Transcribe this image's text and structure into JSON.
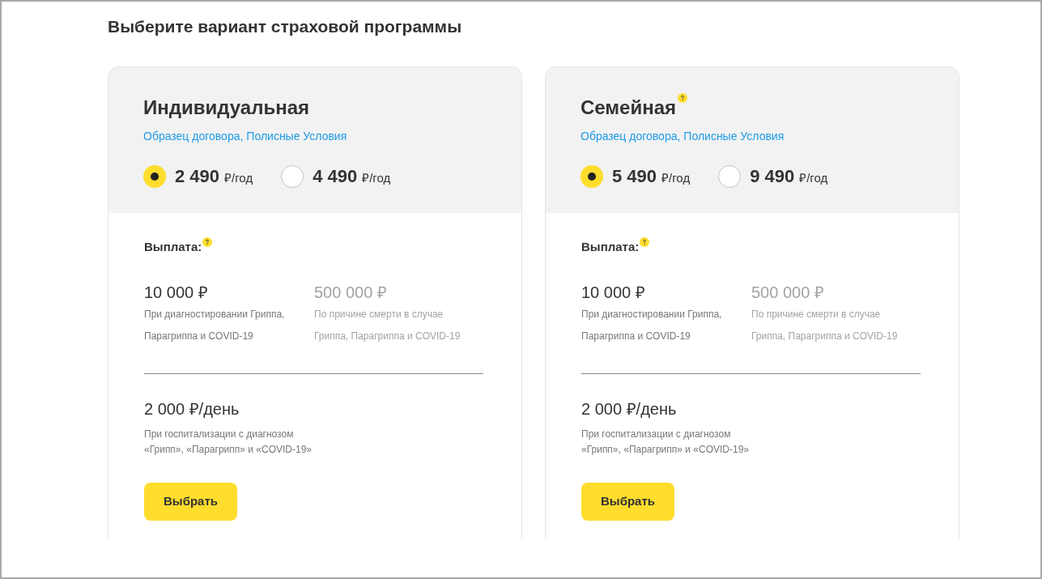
{
  "heading": "Выберите вариант страховой программы",
  "plans": [
    {
      "title": "Индивидуальная",
      "title_help": false,
      "links": [
        "Образец договора,",
        "Полисные Условия"
      ],
      "options": [
        {
          "amount": "2 490",
          "unit": "₽/год",
          "selected": true
        },
        {
          "amount": "4 490",
          "unit": "₽/год",
          "selected": false
        }
      ],
      "payout_label": "Выплата:",
      "payouts": [
        {
          "amount": "10 000 ₽",
          "description": "При диагностировании Гриппа,\nПарагриппа и COVID-19",
          "disabled": false
        },
        {
          "amount": "500 000 ₽",
          "description": "По причине смерти в случае\nГриппа, Парагриппа и COVID-19",
          "disabled": true
        }
      ],
      "daily_amount": "2 000 ₽/день",
      "daily_description": "При госпитализации с диагнозом\n«Грипп», «Парагрипп» и «COVID-19»",
      "button": "Выбрать"
    },
    {
      "title": "Семейная",
      "title_help": true,
      "links": [
        "Образец договора,",
        "Полисные Условия"
      ],
      "options": [
        {
          "amount": "5 490",
          "unit": "₽/год",
          "selected": true
        },
        {
          "amount": "9 490",
          "unit": "₽/год",
          "selected": false
        }
      ],
      "payout_label": "Выплата:",
      "payouts": [
        {
          "amount": "10 000 ₽",
          "description": "При диагностировании Гриппа,\nПарагриппа и COVID-19",
          "disabled": false
        },
        {
          "amount": "500 000 ₽",
          "description": "По причине смерти в случае\nГриппа, Парагриппа и COVID-19",
          "disabled": true
        }
      ],
      "daily_amount": "2 000 ₽/день",
      "daily_description": "При госпитализации с диагнозом\n«Грипп», «Парагрипп» и «COVID-19»",
      "button": "Выбрать"
    }
  ]
}
